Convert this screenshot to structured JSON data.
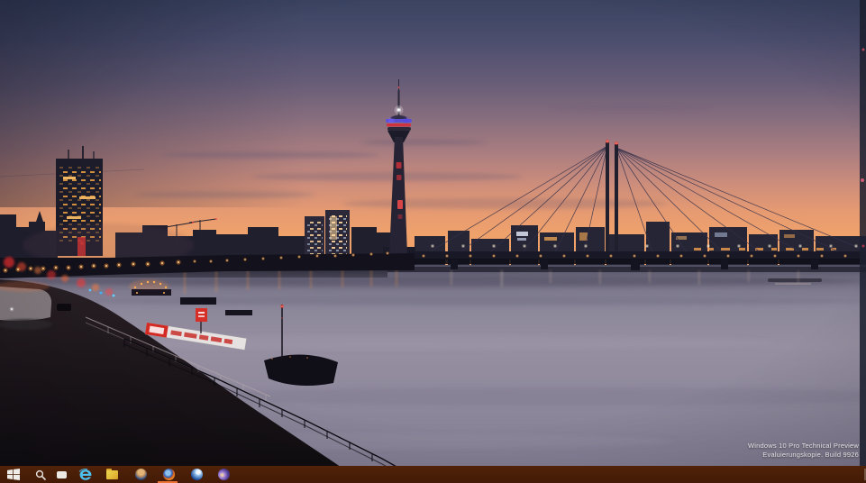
{
  "desktop": {
    "watermark": {
      "line1": "Windows 10 Pro Technical Preview",
      "line2": "Evaluierungskopie. Build 9926"
    },
    "wallpaper": {
      "scene": "Duesseldorf Rhine riverside at dusk: Rheinturm tower, cable-stayed bridge, smooth river, lit promenade",
      "colors": {
        "sky_top": "#3a4361",
        "sky_horizon": "#f0a26b",
        "water": "#968fa1",
        "silhouette": "#201f2e",
        "promenade_lamp": "#ff932e"
      }
    }
  },
  "taskbar": {
    "background_color": "#4a1e07",
    "active_indicator_color": "#ed7434",
    "buttons": [
      {
        "name": "start",
        "icon": "windows-logo-icon"
      },
      {
        "name": "search",
        "icon": "search-icon"
      },
      {
        "name": "task-view",
        "icon": "task-view-icon"
      },
      {
        "name": "internet-explorer",
        "icon": "internet-explorer-icon"
      },
      {
        "name": "file-explorer",
        "icon": "folder-icon"
      },
      {
        "name": "globe-app",
        "icon": "globe-app-icon"
      },
      {
        "name": "firefox",
        "icon": "firefox-icon",
        "active": true
      },
      {
        "name": "blue-sphere-app",
        "icon": "blue-sphere-app-icon"
      },
      {
        "name": "purple-sphere-app",
        "icon": "purple-sphere-app-icon"
      }
    ]
  }
}
